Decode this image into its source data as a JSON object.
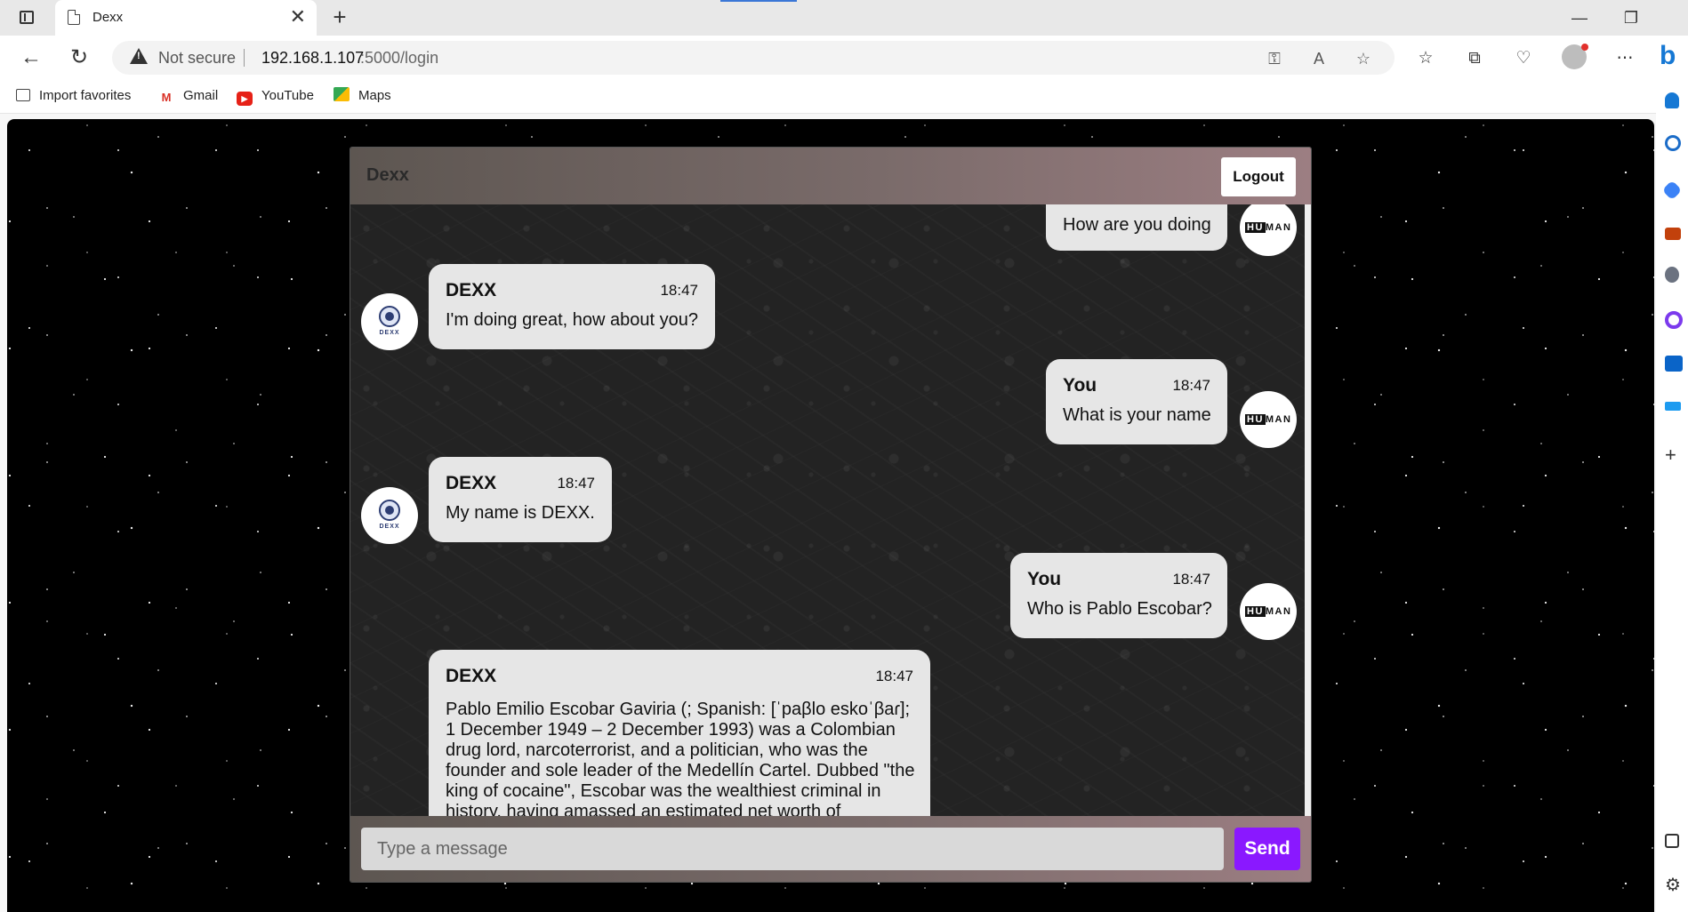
{
  "browser": {
    "tab_title": "Dexx",
    "tab_close": "✕",
    "new_tab": "+",
    "window_controls": [
      "—",
      "❐"
    ],
    "not_secure_label": "Not secure",
    "url_host": "192.168.1.107",
    "url_path": ":5000/login",
    "favorites": [
      "Import favorites",
      "Gmail",
      "YouTube",
      "Maps"
    ],
    "accent_color": "#1678d4"
  },
  "chat": {
    "app_title": "Dexx",
    "logout_label": "Logout",
    "human_logo_hu": "HU",
    "human_logo_rest": "MAN",
    "bot_brand": "DEXX",
    "messages": [
      {
        "sender": "",
        "time": "",
        "text": "How are you doing",
        "role": "user"
      },
      {
        "sender": "DEXX",
        "time": "18:47",
        "text": "I'm doing great, how about you?",
        "role": "bot"
      },
      {
        "sender": "You",
        "time": "18:47",
        "text": "What is your name",
        "role": "user"
      },
      {
        "sender": "DEXX",
        "time": "18:47",
        "text": "My name is DEXX.",
        "role": "bot"
      },
      {
        "sender": "You",
        "time": "18:47",
        "text": "Who is Pablo Escobar?",
        "role": "user"
      },
      {
        "sender": "DEXX",
        "time": "18:47",
        "text": "Pablo Emilio Escobar Gaviria (; Spanish: [ˈpaβlo eskoˈβaɾ]; 1 December 1949 – 2 December 1993) was a Colombian drug lord, narcoterrorist, and a politician, who was the founder and sole leader of the Medellín Cartel. Dubbed \"the king of cocaine\", Escobar was the wealthiest criminal in history, having amassed an estimated net worth of",
        "role": "bot"
      }
    ],
    "input_placeholder": "Type a message",
    "send_label": "Send",
    "send_color": "#8a18ff"
  }
}
